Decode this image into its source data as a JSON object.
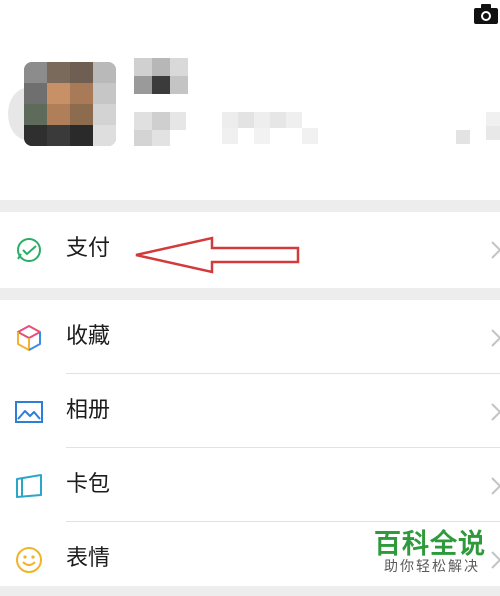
{
  "menu": {
    "pay": {
      "label": "支付",
      "icon": "pay-icon"
    },
    "favorites": {
      "label": "收藏",
      "icon": "cube-icon"
    },
    "album": {
      "label": "相册",
      "icon": "image-icon"
    },
    "cards": {
      "label": "卡包",
      "icon": "card-icon"
    },
    "stickers": {
      "label": "表情",
      "icon": "smiley-icon"
    }
  },
  "annotation": {
    "color": "#d23b3b"
  },
  "watermark": {
    "title": "百科全说",
    "subtitle": "助你轻松解决",
    "color": "#2e9a3c"
  }
}
